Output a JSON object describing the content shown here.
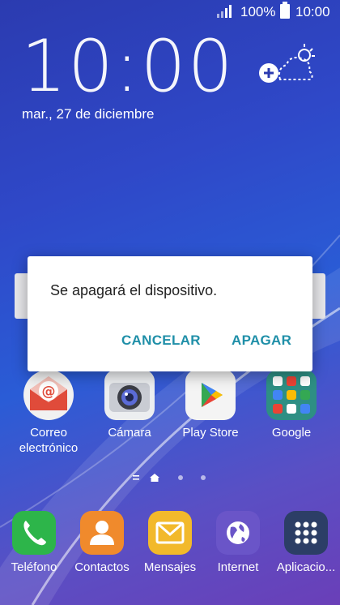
{
  "status_bar": {
    "battery": "100%",
    "time": "10:00"
  },
  "lock": {
    "clock": "10:00",
    "date": "mar., 27 de diciembre"
  },
  "apps": [
    {
      "label": "Correo\nelectrónico",
      "icon": "email-icon"
    },
    {
      "label": "Cámara",
      "icon": "camera-icon"
    },
    {
      "label": "Play Store",
      "icon": "play-store-icon"
    },
    {
      "label": "Google",
      "icon": "google-folder-icon"
    }
  ],
  "dock": [
    {
      "label": "Teléfono",
      "icon": "phone-icon"
    },
    {
      "label": "Contactos",
      "icon": "contacts-icon"
    },
    {
      "label": "Mensajes",
      "icon": "messages-icon"
    },
    {
      "label": "Internet",
      "icon": "internet-icon"
    },
    {
      "label": "Aplicacio...",
      "icon": "apps-grid-icon"
    }
  ],
  "dialog": {
    "message": "Se apagará el dispositivo.",
    "cancel": "CANCELAR",
    "confirm": "APAGAR"
  },
  "colors": {
    "accent": "#1f8fa8"
  }
}
